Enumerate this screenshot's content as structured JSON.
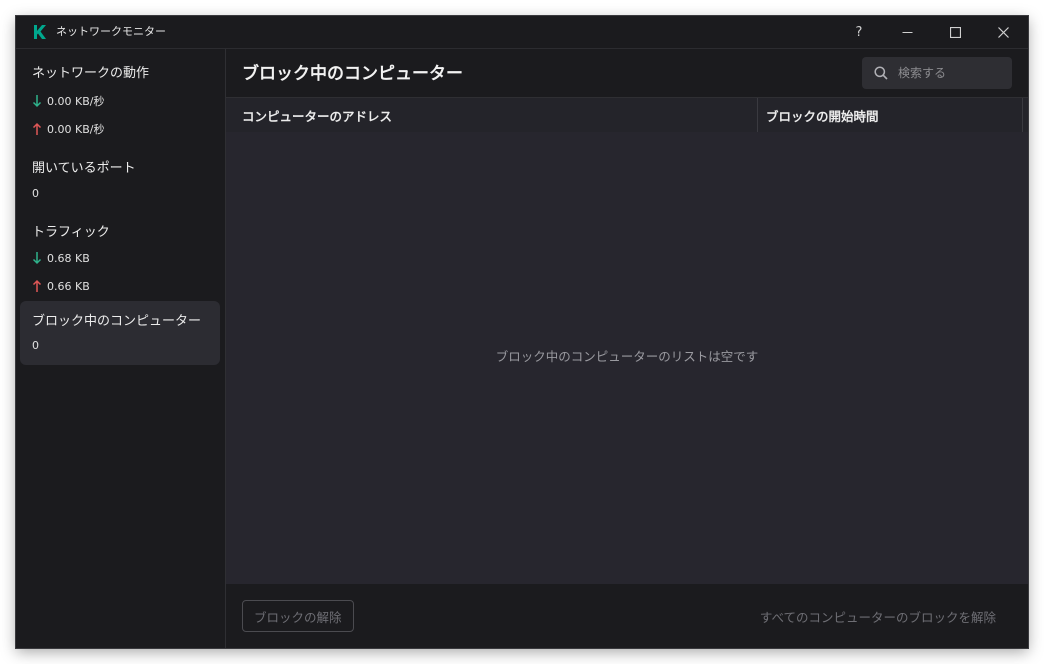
{
  "window": {
    "title": "ネットワークモニター",
    "help_label": "?"
  },
  "colors": {
    "accent": "#00a88e",
    "download_arrow": "#2fb38c",
    "upload_arrow": "#e05757"
  },
  "sidebar": {
    "network_activity": {
      "title": "ネットワークの動作",
      "download": "0.00 KB/秒",
      "upload": "0.00 KB/秒"
    },
    "open_ports": {
      "title": "開いているポート",
      "value": "0"
    },
    "traffic": {
      "title": "トラフィック",
      "download": "0.68 KB",
      "upload": "0.66 KB"
    },
    "blocked_computers": {
      "title": "ブロック中のコンピューター",
      "value": "0"
    }
  },
  "main": {
    "title": "ブロック中のコンピューター",
    "search": {
      "placeholder": "検索する"
    },
    "table": {
      "columns": [
        "コンピューターのアドレス",
        "ブロックの開始時間"
      ],
      "rows": [],
      "empty_message": "ブロック中のコンピューターのリストは空です"
    },
    "footer": {
      "unblock_label": "ブロックの解除",
      "unblock_all_label": "すべてのコンピューターのブロックを解除"
    }
  }
}
